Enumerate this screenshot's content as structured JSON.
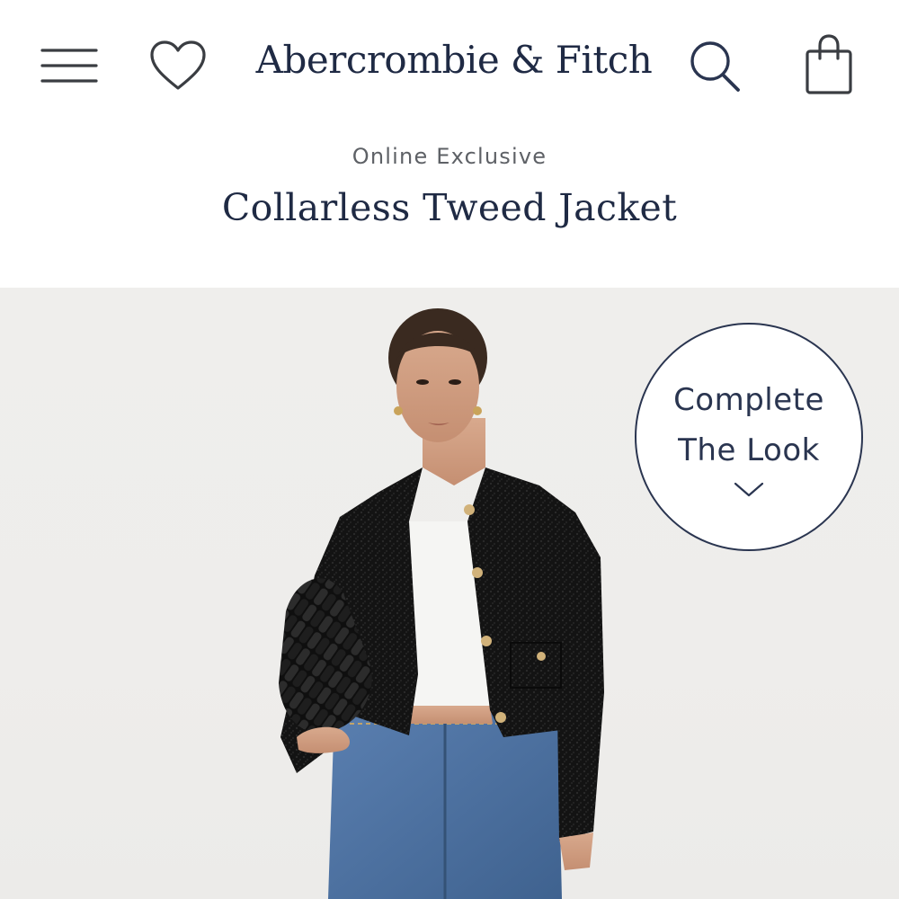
{
  "header": {
    "brand": "Abercrombie & Fitch",
    "icons": {
      "menu": "hamburger-menu-icon",
      "wishlist": "heart-icon",
      "search": "search-icon",
      "bag": "shopping-bag-icon"
    }
  },
  "product": {
    "eyebrow": "Online Exclusive",
    "title": "Collarless Tweed Jacket"
  },
  "complete_the_look": {
    "line1": "Complete",
    "line2": "The Look",
    "icon": "chevron-down-icon"
  },
  "colors": {
    "navy": "#1f2a44",
    "gray_text": "#5e6166",
    "image_bg": "#eeedeb"
  }
}
